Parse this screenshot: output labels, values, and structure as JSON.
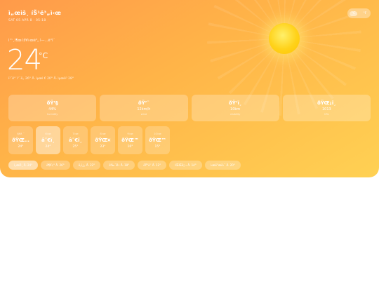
{
  "header": {
    "city": "ì„œìš¸ íŠ¹ë³„ì‹œ",
    "date": "SAT 05 APR 8 · 05:18",
    "units": {
      "metric": "°C",
      "imperial": "°F"
    }
  },
  "current": {
    "condition": "ì™¸ì¶œ ìž¥ì‹œë³„ ì—…ë°ì´",
    "temperature": "24",
    "unit": "°C",
    "feels": "ì²´ê° ì˜¨ë„ 26° Â· ìµœì € 20° Â· ìµœê³  28°"
  },
  "stats": [
    {
      "icon": "ðŸ’§",
      "value": "44%",
      "label": "humidity"
    },
    {
      "icon": "ðŸ’¨",
      "value": "12km/h",
      "label": "wind"
    },
    {
      "icon": "ðŸ‘ï¸",
      "value": "10km",
      "label": "visibility"
    },
    {
      "icon": "ðŸŒ¡ï¸",
      "value": "1013",
      "label": "hPa"
    }
  ],
  "hourly": [
    {
      "time": "ì§€ê¸ˆ",
      "icon": "ðŸŒ…",
      "temp": "24°"
    },
    {
      "time": "6ì‹œ",
      "icon": "â˜€ï¸",
      "temp": "24°"
    },
    {
      "time": "7ì‹œ",
      "icon": "â˜€ï¸",
      "temp": "25°"
    },
    {
      "time": "8ì‹œ",
      "icon": "ðŸŒ¤",
      "temp": "23°"
    },
    {
      "time": "9ì‹œ",
      "icon": "ðŸŒ™",
      "temp": "16°"
    },
    {
      "time": "10ì‹œ",
      "icon": "ðŸŒ™",
      "temp": "15°"
    }
  ],
  "cities": [
    {
      "label": "ì„œìš¸ Â· 24°"
    },
    {
      "label": "ë¶€ì‚° Â· 26°"
    },
    {
      "label": "ë„ì¿„ Â· 22°"
    },
    {
      "label": "ë‰´ìš• Â· 18°"
    },
    {
      "label": "ëŸ°ë˜ Â· 12°"
    },
    {
      "label": "íŒŒë¦¬ Â· 14°"
    },
    {
      "label": "ì‹œë“œë‹ˆ Â· 20°"
    }
  ]
}
